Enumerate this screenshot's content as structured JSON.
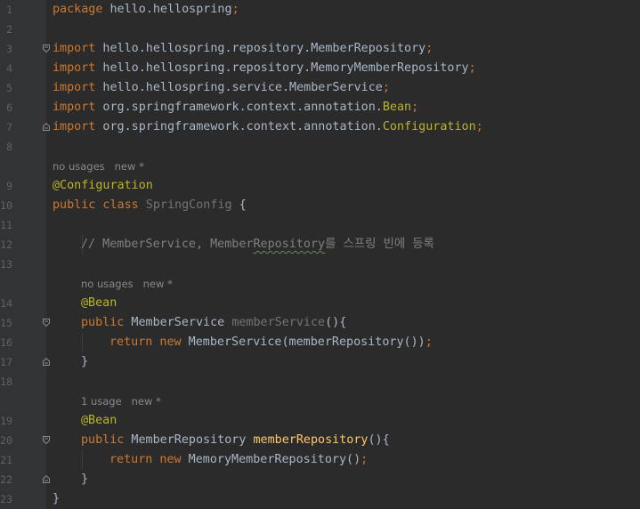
{
  "editor": {
    "lines": {
      "l1": {
        "num": "1",
        "t1": "package",
        "t2": " hello.hellospring",
        "t3": ";"
      },
      "l2": {
        "num": "2"
      },
      "l3": {
        "num": "3",
        "t1": "import",
        "t2": " hello.hellospring.repository.MemberRepository",
        "t3": ";"
      },
      "l4": {
        "num": "4",
        "t1": "import",
        "t2": " hello.hellospring.repository.MemoryMemberRepository",
        "t3": ";"
      },
      "l5": {
        "num": "5",
        "t1": "import",
        "t2": " hello.hellospring.service.MemberService",
        "t3": ";"
      },
      "l6": {
        "num": "6",
        "t1": "import",
        "t2": " org.springframework.context.annotation.",
        "t3": "Bean",
        "t4": ";"
      },
      "l7": {
        "num": "7",
        "t1": "import",
        "t2": " org.springframework.context.annotation.",
        "t3": "Configuration",
        "t4": ";"
      },
      "l8": {
        "num": "8"
      },
      "h1": {
        "text": "no usages   new *"
      },
      "l9": {
        "num": "9",
        "t1": "@Configuration"
      },
      "l10": {
        "num": "10",
        "t1": "public class",
        "t2": " SpringConfig",
        "t3": " {"
      },
      "l11": {
        "num": "11"
      },
      "l12": {
        "num": "12",
        "t1": "// MemberService, Member",
        "t2": "Repository",
        "t3": "를 스프링 빈에 등록"
      },
      "l13": {
        "num": "13"
      },
      "h2": {
        "text": "no usages   new *"
      },
      "l14": {
        "num": "14",
        "t1": "@Bean"
      },
      "l15": {
        "num": "15",
        "t1": "public",
        "t2": " MemberService ",
        "t3": "memberService",
        "t4": "(){"
      },
      "l16": {
        "num": "16",
        "t1": "return new",
        "t2": " MemberService(memberRepository())",
        "t3": ";"
      },
      "l17": {
        "num": "17",
        "t1": "}"
      },
      "l18": {
        "num": "18"
      },
      "h3": {
        "text": "1 usage   new *"
      },
      "l19": {
        "num": "19",
        "t1": "@Bean"
      },
      "l20": {
        "num": "20",
        "t1": "public",
        "t2": " MemberRepository ",
        "t3": "memberRepository",
        "t4": "(){"
      },
      "l21": {
        "num": "21",
        "t1": "return new",
        "t2": " MemoryMemberRepository()",
        "t3": ";"
      },
      "l22": {
        "num": "22",
        "t1": "}"
      },
      "l23": {
        "num": "23",
        "t1": "}"
      }
    }
  }
}
